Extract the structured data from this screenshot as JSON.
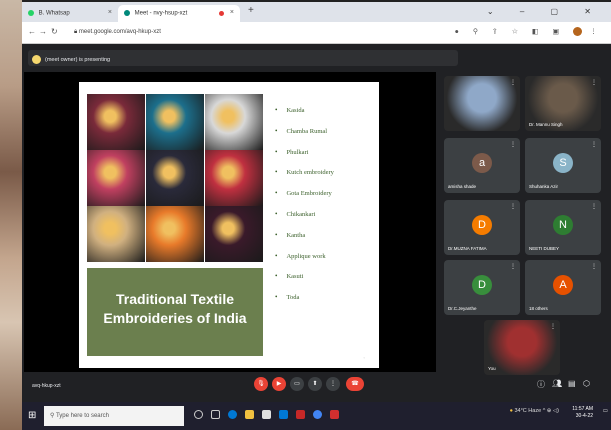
{
  "browser": {
    "tabs": [
      {
        "title": "B. Whatsap",
        "active": false
      },
      {
        "title": "Meet - nvy-hsup-xzt",
        "active": true
      }
    ],
    "new_tab": "+",
    "url": "meet.google.com/avq-hkup-xzt"
  },
  "meet": {
    "presenting_text": "(meet owner) is presenting",
    "meeting_code": "avq-hkup-xzt",
    "slide": {
      "title_line1": "Traditional Textile",
      "title_line2": "Embroideries of India",
      "items": [
        "Kasida",
        "Chamba Rumal",
        "Phulkari",
        "Kutch embroidery",
        "Gota Embroidery",
        "Chikankari",
        "Kantha",
        "Applique work",
        "Kasuti",
        "Toda"
      ],
      "collage_colors": [
        "#7a2a3a",
        "#1c6f8c",
        "#d8d8d8",
        "#c04060",
        "#2a2a3a",
        "#c03040",
        "#d0b080",
        "#e87a2a",
        "#3a1a2a"
      ]
    },
    "participants": [
      {
        "name": "",
        "kind": "video",
        "color": "#8fa8c8"
      },
      {
        "name": "Dr. Mannu Singh",
        "kind": "video",
        "color": "#6a5a4a"
      },
      {
        "name": "amisha shade",
        "kind": "avatar",
        "letter": "a",
        "color": "#7c5a4a"
      },
      {
        "name": "Shuhanka Azir",
        "kind": "avatar",
        "letter": "S",
        "color": "#8ab4c8"
      },
      {
        "name": "Dr.MUZNA FATIMA",
        "kind": "avatar",
        "letter": "D",
        "color": "#f57c00"
      },
      {
        "name": "NEETI DUBEY",
        "kind": "avatar",
        "letter": "N",
        "color": "#2e7d32"
      },
      {
        "name": "Dr.C.Jeyanthe",
        "kind": "avatar",
        "letter": "D",
        "color": "#388e3c"
      },
      {
        "name": "18 others",
        "kind": "others",
        "letter": "A",
        "color": "#e65100"
      },
      {
        "name": "You",
        "kind": "self",
        "color": "#a03030"
      }
    ]
  },
  "taskbar": {
    "search_placeholder": "Type here to search",
    "weather": "34°C Haze",
    "time": "11:57 AM",
    "date": "30-4-22"
  }
}
